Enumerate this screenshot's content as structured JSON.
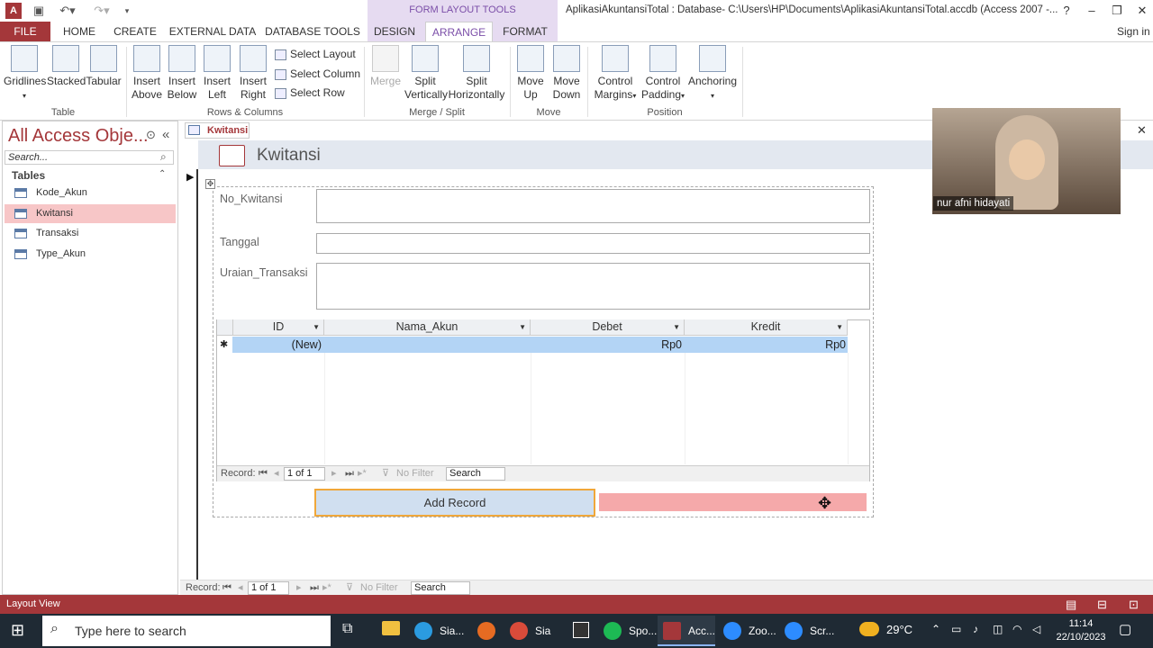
{
  "title_bar": {
    "context_group": "FORM LAYOUT TOOLS",
    "window_title": "AplikasiAkuntansiTotal : Database- C:\\Users\\HP\\Documents\\AplikasiAkuntansiTotal.accdb (Access 2007 -...",
    "help": "?"
  },
  "tabs": {
    "file": "FILE",
    "home": "HOME",
    "create": "CREATE",
    "external": "EXTERNAL DATA",
    "dbtools": "DATABASE TOOLS",
    "design": "DESIGN",
    "arrange": "ARRANGE",
    "format": "FORMAT",
    "signin": "Sign in"
  },
  "ribbon": {
    "gridlines": "Gridlines",
    "stacked": "Stacked",
    "tabular": "Tabular",
    "insert_above_1": "Insert",
    "insert_above_2": "Above",
    "insert_below_1": "Insert",
    "insert_below_2": "Below",
    "insert_left_1": "Insert",
    "insert_left_2": "Left",
    "insert_right_1": "Insert",
    "insert_right_2": "Right",
    "select_layout": "Select Layout",
    "select_column": "Select Column",
    "select_row": "Select Row",
    "merge": "Merge",
    "split_v_1": "Split",
    "split_v_2": "Vertically",
    "split_h_1": "Split",
    "split_h_2": "Horizontally",
    "move_up_1": "Move",
    "move_up_2": "Up",
    "move_down_1": "Move",
    "move_down_2": "Down",
    "control_margins_1": "Control",
    "control_margins_2": "Margins",
    "control_padding_1": "Control",
    "control_padding_2": "Padding",
    "anchoring": "Anchoring",
    "group_table": "Table",
    "group_rows_cols": "Rows & Columns",
    "group_merge": "Merge / Split",
    "group_move": "Move",
    "group_position": "Position"
  },
  "nav_pane": {
    "title": "All Access Obje...",
    "search_placeholder": "Search...",
    "section": "Tables",
    "items": [
      "Kode_Akun",
      "Kwitansi",
      "Transaksi",
      "Type_Akun"
    ]
  },
  "document": {
    "tab": "Kwitansi",
    "form_title": "Kwitansi",
    "fields": {
      "no_kwitansi": "No_Kwitansi",
      "tanggal": "Tanggal",
      "uraian": "Uraian_Transaksi"
    },
    "subform": {
      "columns": [
        "ID",
        "Nama_Akun",
        "Debet",
        "Kredit"
      ],
      "new_row": {
        "marker": "✱",
        "id": "(New)",
        "debet": "Rp0",
        "kredit": "Rp0"
      },
      "nav": {
        "record_label": "Record:",
        "position": "1 of 1",
        "filter": "No Filter",
        "search": "Search"
      }
    },
    "add_record": "Add Record",
    "bottom_nav": {
      "record_label": "Record:",
      "position": "1 of 1",
      "filter": "No Filter",
      "search": "Search"
    }
  },
  "status_bar": {
    "view": "Layout View"
  },
  "video": {
    "name": "nur afni hidayati"
  },
  "taskbar": {
    "search_placeholder": "Type here to search",
    "apps": [
      "Sia...",
      "Sia ...",
      "Spo...",
      "Acc...",
      "Zoo...",
      "Scr..."
    ],
    "weather": "29°C",
    "time": "11:14",
    "date": "22/10/2023"
  }
}
